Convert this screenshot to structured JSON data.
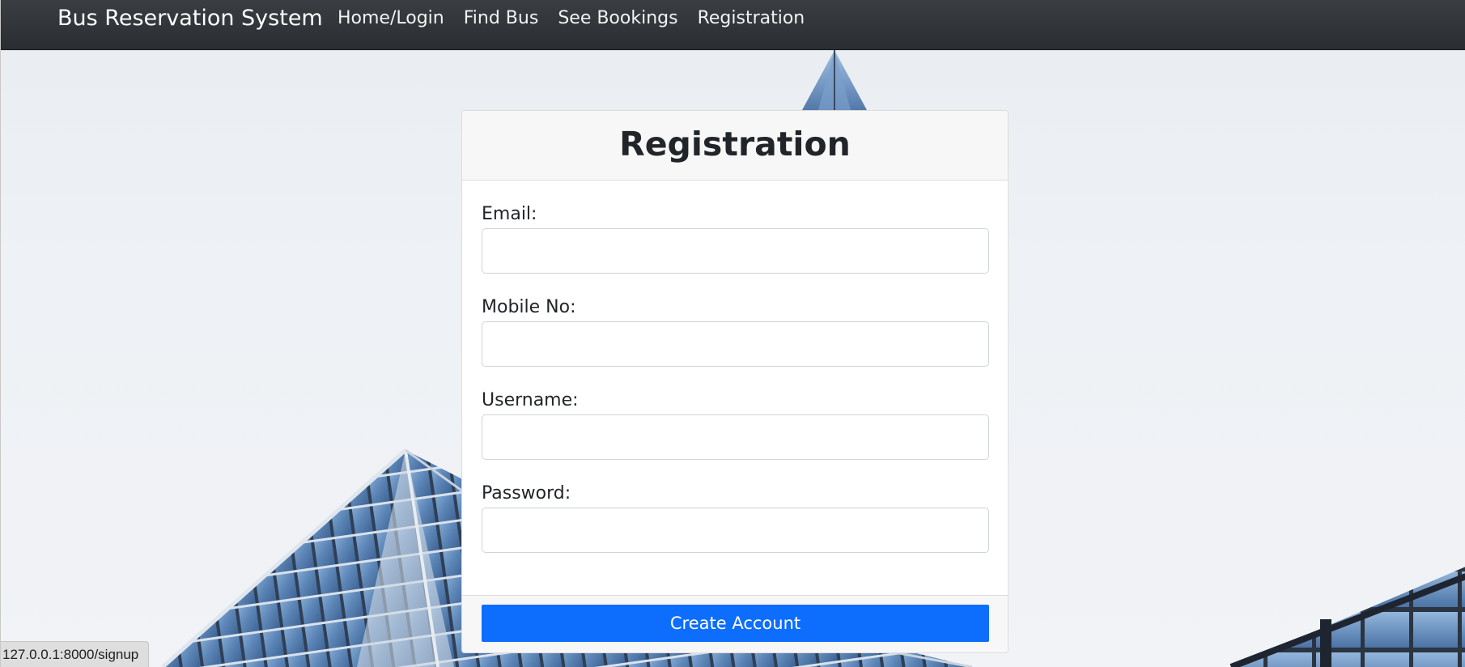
{
  "navbar": {
    "brand": "Bus Reservation System",
    "links": [
      {
        "label": "Home/Login"
      },
      {
        "label": "Find Bus"
      },
      {
        "label": "See Bookings"
      },
      {
        "label": "Registration"
      }
    ]
  },
  "form": {
    "title": "Registration",
    "fields": [
      {
        "label": "Email:",
        "value": "",
        "placeholder": ""
      },
      {
        "label": "Mobile No:",
        "value": "",
        "placeholder": ""
      },
      {
        "label": "Username:",
        "value": "",
        "placeholder": ""
      },
      {
        "label": "Password:",
        "value": "",
        "placeholder": ""
      }
    ],
    "submit_label": "Create Account"
  },
  "status_bar": {
    "url": "127.0.0.1:8000/signup"
  },
  "colors": {
    "navbar": "#2a2d31",
    "primary": "#0d6efd",
    "card_header": "#f7f7f7"
  }
}
